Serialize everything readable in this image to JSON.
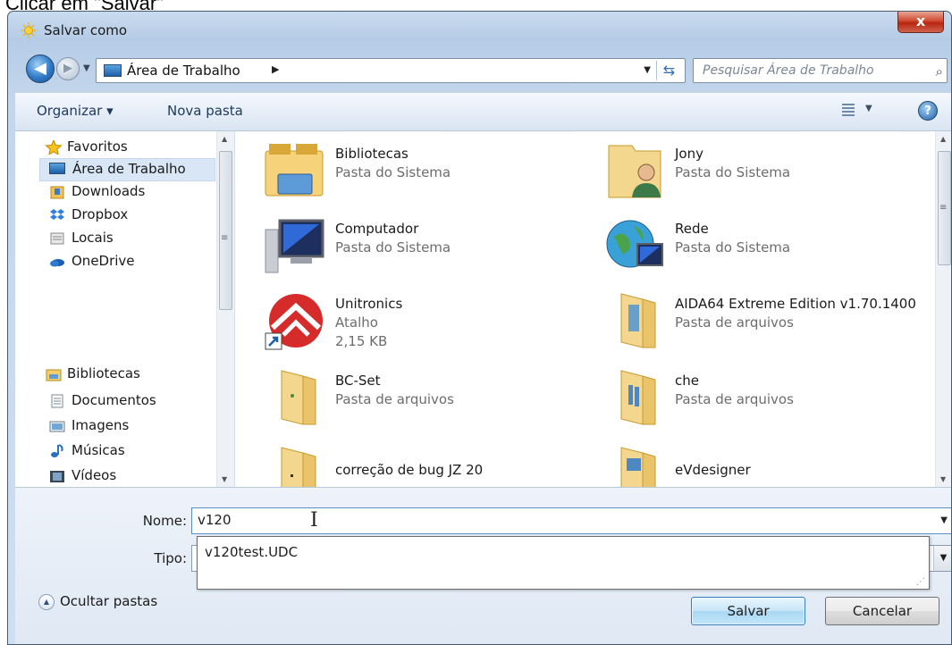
{
  "caption": "Clicar em \"Salvar\"",
  "window": {
    "title": "Salvar como",
    "close_glyph": "x"
  },
  "nav": {
    "back_glyph": "◀",
    "forward_glyph": "▶",
    "address": "Área de Trabalho",
    "address_arrow": "▶",
    "search_placeholder": "Pesquisar Área de Trabalho"
  },
  "toolbar": {
    "organize": "Organizar ▾",
    "new_folder": "Nova pasta",
    "help": "?"
  },
  "sidebar": {
    "items": [
      {
        "label": "Favoritos",
        "icon": "star-icon"
      },
      {
        "label": "Área de Trabalho",
        "icon": "desktop-icon"
      },
      {
        "label": "Downloads",
        "icon": "downloads-icon"
      },
      {
        "label": "Dropbox",
        "icon": "dropbox-icon"
      },
      {
        "label": "Locais",
        "icon": "locais-icon"
      },
      {
        "label": "OneDrive",
        "icon": "onedrive-icon"
      },
      {
        "label": "Bibliotecas",
        "icon": "libraries-icon"
      },
      {
        "label": "Documentos",
        "icon": "documents-icon"
      },
      {
        "label": "Imagens",
        "icon": "images-icon"
      },
      {
        "label": "Músicas",
        "icon": "music-icon"
      },
      {
        "label": "Vídeos",
        "icon": "videos-icon"
      }
    ]
  },
  "files": [
    {
      "name": "Bibliotecas",
      "type": "Pasta do Sistema",
      "icon": "libraries-folder-icon"
    },
    {
      "name": "Jony",
      "type": "Pasta do Sistema",
      "icon": "user-folder-icon"
    },
    {
      "name": "Computador",
      "type": "Pasta do Sistema",
      "icon": "computer-icon"
    },
    {
      "name": "Rede",
      "type": "Pasta do Sistema",
      "icon": "network-icon"
    },
    {
      "name": "Unitronics",
      "type": "Atalho",
      "size": "2,15 KB",
      "icon": "unitronics-shortcut-icon"
    },
    {
      "name": "AIDA64 Extreme Edition v1.70.1400",
      "type": "Pasta de arquivos",
      "icon": "folder-icon"
    },
    {
      "name": "BC-Set",
      "type": "Pasta de arquivos",
      "icon": "folder-icon"
    },
    {
      "name": "che",
      "type": "Pasta de arquivos",
      "icon": "folder-icon"
    },
    {
      "name": "correção de bug JZ 20",
      "type": "",
      "icon": "folder-icon"
    },
    {
      "name": "eVdesigner",
      "type": "",
      "icon": "folder-icon"
    }
  ],
  "form": {
    "name_label": "Nome:",
    "name_value": "v120",
    "type_label": "Tipo:",
    "suggestion": "v120test.UDC"
  },
  "footer": {
    "hide_folders": "Ocultar pastas",
    "save": "Salvar",
    "cancel": "Cancelar"
  },
  "colors": {
    "accent": "#3b7ec0",
    "close": "#cf4a31",
    "selection": "#d8e6f5"
  }
}
